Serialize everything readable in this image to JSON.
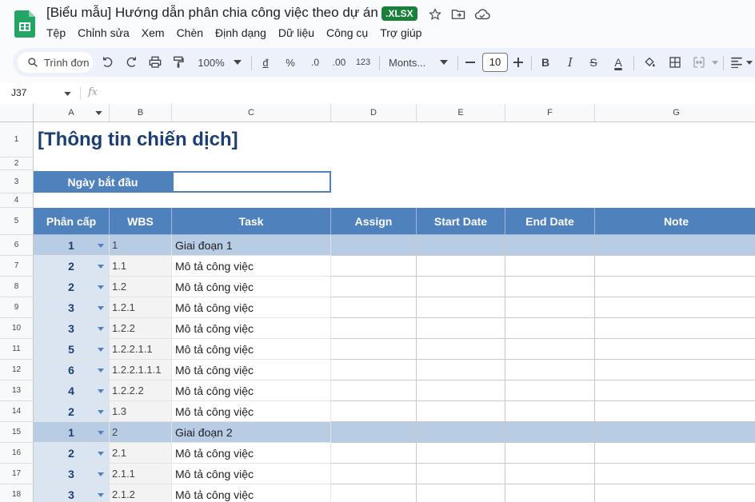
{
  "header": {
    "doc_title": "[Biểu mẫu] Hướng dẫn phân chia công việc theo dự án",
    "file_badge": ".XLSX",
    "icons": [
      "star-icon",
      "move-to-folder-icon",
      "cloud-status-icon"
    ]
  },
  "menu": [
    "Tệp",
    "Chỉnh sửa",
    "Xem",
    "Chèn",
    "Định dạng",
    "Dữ liệu",
    "Công cụ",
    "Trợ giúp"
  ],
  "toolbar": {
    "search_label": "Trình đơn",
    "zoom": "100%",
    "currency_symbol": "đ",
    "percent_symbol": "%",
    "decrease_decimal": ".0",
    "increase_decimal": ".00",
    "number_format": "123",
    "font": "Monts...",
    "font_size": "10",
    "bold": "B",
    "italic": "I",
    "strike": "S",
    "text_color": "A"
  },
  "formula_bar": {
    "cell_ref": "J37",
    "fx": "fx"
  },
  "columns": [
    "A",
    "B",
    "C",
    "D",
    "E",
    "F",
    "G"
  ],
  "sheet": {
    "title": "[Thông tin chiến dịch]",
    "start_date_label": "Ngày bắt đầu",
    "start_date_value": "",
    "table_headers": [
      "Phân cấp",
      "WBS",
      "Task",
      "Assign",
      "Start Date",
      "End Date",
      "Note"
    ],
    "rows": [
      {
        "row": "6",
        "level": "1",
        "wbs": "1",
        "task": "Giai đoạn 1",
        "phase": true
      },
      {
        "row": "7",
        "level": "2",
        "wbs": "1.1",
        "task": "Mô tả công việc",
        "phase": false
      },
      {
        "row": "8",
        "level": "2",
        "wbs": "1.2",
        "task": "Mô tả công việc",
        "phase": false
      },
      {
        "row": "9",
        "level": "3",
        "wbs": "1.2.1",
        "task": "Mô tả công việc",
        "phase": false
      },
      {
        "row": "10",
        "level": "3",
        "wbs": "1.2.2",
        "task": "Mô tả công việc",
        "phase": false
      },
      {
        "row": "11",
        "level": "5",
        "wbs": "1.2.2.1.1",
        "task": "Mô tả công việc",
        "phase": false
      },
      {
        "row": "12",
        "level": "6",
        "wbs": "1.2.2.1.1.1",
        "task": "Mô tả công việc",
        "phase": false
      },
      {
        "row": "13",
        "level": "4",
        "wbs": "1.2.2.2",
        "task": "Mô tả công việc",
        "phase": false
      },
      {
        "row": "14",
        "level": "2",
        "wbs": "1.3",
        "task": "Mô tả công việc",
        "phase": false
      },
      {
        "row": "15",
        "level": "1",
        "wbs": "2",
        "task": "Giai đoạn 2",
        "phase": true
      },
      {
        "row": "16",
        "level": "2",
        "wbs": "2.1",
        "task": "Mô tả công việc",
        "phase": false
      },
      {
        "row": "17",
        "level": "3",
        "wbs": "2.1.1",
        "task": "Mô tả công việc",
        "phase": false
      },
      {
        "row": "18",
        "level": "3",
        "wbs": "2.1.2",
        "task": "Mô tả công việc",
        "phase": false
      }
    ],
    "top_rows": [
      "1",
      "2",
      "3",
      "4",
      "5"
    ]
  },
  "colors": {
    "header_blue": "#4f81bd",
    "level_fill": "#dbe5f1",
    "phase_fill": "#b8cce4",
    "title_color": "#1c3f73",
    "badge_green": "#188038"
  }
}
